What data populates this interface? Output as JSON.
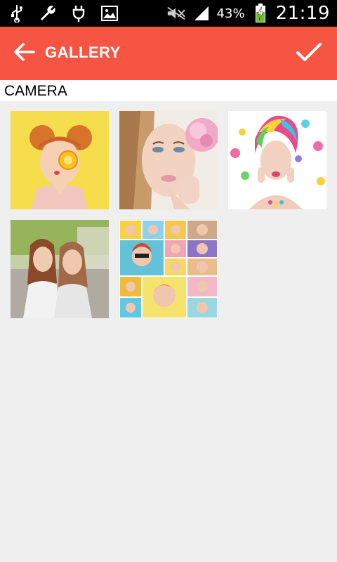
{
  "status_bar": {
    "battery_percent": "43%",
    "time": "21:19",
    "icons": [
      "usb-icon",
      "wrench-icon",
      "plug-icon",
      "image-icon",
      "mute-icon",
      "signal-icon",
      "battery-charging-icon"
    ]
  },
  "app_bar": {
    "title": "GALLERY",
    "background_color": "#f75544",
    "back_icon": "arrow-left-icon",
    "confirm_icon": "check-icon"
  },
  "section": {
    "title": "CAMERA"
  },
  "photos": [
    {
      "name": "photo-1",
      "description": "yellow background portrait"
    },
    {
      "name": "photo-2",
      "description": "close-up portrait with flower"
    },
    {
      "name": "photo-3",
      "description": "colorful hair portrait"
    },
    {
      "name": "photo-4",
      "description": "two friends outdoors"
    },
    {
      "name": "photo-5",
      "description": "collage"
    }
  ]
}
